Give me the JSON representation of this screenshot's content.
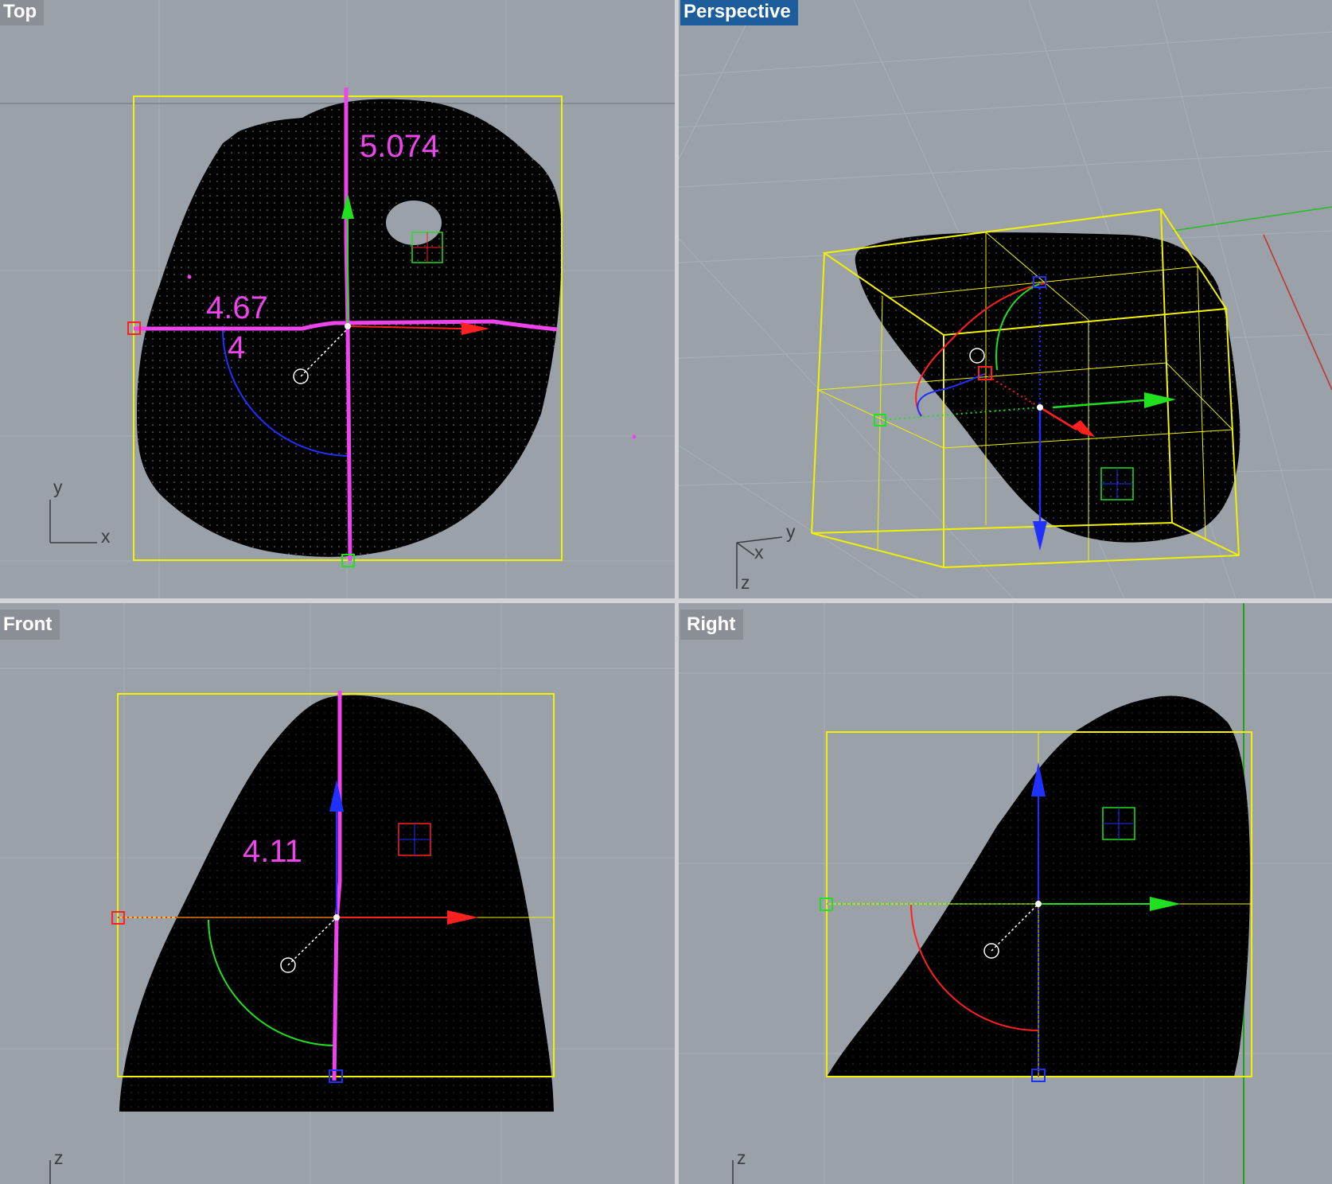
{
  "viewports": {
    "top": {
      "label": "Top",
      "dims": {
        "height": "5.074",
        "width": "4.67",
        "angle": "4"
      },
      "axes": {
        "first": "y",
        "second": "x"
      }
    },
    "perspective": {
      "label": "Perspective",
      "axes": {
        "y": "y",
        "x": "x",
        "z": "z"
      }
    },
    "front": {
      "label": "Front",
      "dims": {
        "height": "4.11"
      },
      "axes": {
        "z": "z"
      }
    },
    "right": {
      "label": "Right",
      "axes": {
        "z": "z"
      }
    }
  },
  "colors": {
    "viewport_bg": "#9ba1a9",
    "active_tab": "#1d5d9c",
    "bounding_box": "#f2f200",
    "dimension": "#ee44ee",
    "gizmo_x": "#ff2020",
    "gizmo_y": "#20e020",
    "gizmo_z": "#2030ff"
  },
  "icons": [
    "move-gizmo-icon",
    "rotate-arc-icon",
    "scale-handle-icon",
    "pivot-circle-icon"
  ]
}
